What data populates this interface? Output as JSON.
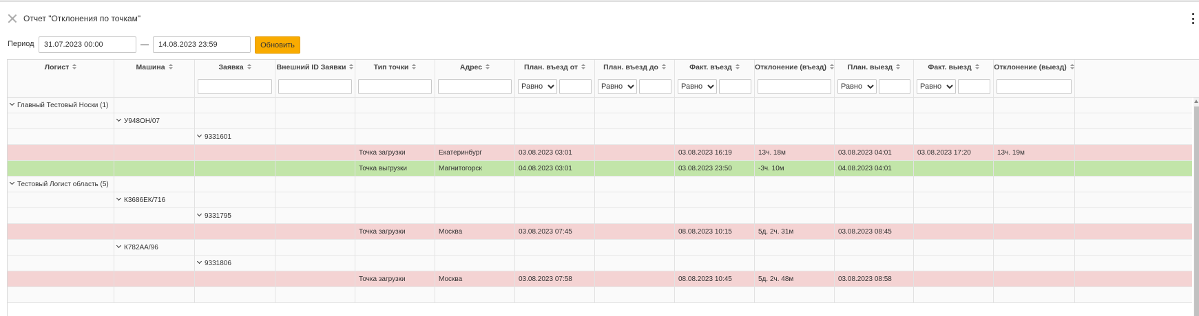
{
  "window": {
    "title": "Отчет \"Отклонения по точкам\""
  },
  "period": {
    "label": "Период",
    "from": "31.07.2023 00:00",
    "separator": "—",
    "to": "14.08.2023 23:59",
    "refresh_label": "Обновить"
  },
  "filter_option": "Равно",
  "columns": [
    {
      "key": "logist",
      "label": "Логист"
    },
    {
      "key": "car",
      "label": "Машина"
    },
    {
      "key": "order",
      "label": "Заявка"
    },
    {
      "key": "ext_id",
      "label": "Внешний ID Заявки"
    },
    {
      "key": "point_type",
      "label": "Тип точки"
    },
    {
      "key": "address",
      "label": "Адрес"
    },
    {
      "key": "plan_in_from",
      "label": "План. въезд от"
    },
    {
      "key": "plan_in_to",
      "label": "План. въезд до"
    },
    {
      "key": "fact_in",
      "label": "Факт. въезд"
    },
    {
      "key": "dev_in",
      "label": "Отклонение (въезд)"
    },
    {
      "key": "plan_out",
      "label": "План. выезд"
    },
    {
      "key": "fact_out",
      "label": "Факт. выезд"
    },
    {
      "key": "dev_out",
      "label": "Отклонение (выезд)"
    }
  ],
  "rows": [
    {
      "kind": "group",
      "level": 0,
      "label": "Главный Тестовый Носки (1)"
    },
    {
      "kind": "group",
      "level": 1,
      "label": "У948ОН/07"
    },
    {
      "kind": "group",
      "level": 2,
      "label": "9331601"
    },
    {
      "kind": "data",
      "status": "red",
      "cells": [
        "",
        "",
        "",
        "",
        "Точка загрузки",
        "Екатеринбург",
        "03.08.2023 03:01",
        "",
        "03.08.2023 16:19",
        "13ч. 18м",
        "03.08.2023 04:01",
        "03.08.2023 17:20",
        "13ч. 19м"
      ]
    },
    {
      "kind": "data",
      "status": "green",
      "cells": [
        "",
        "",
        "",
        "",
        "Точка выгрузки",
        "Магнитогорск",
        "04.08.2023 03:01",
        "",
        "03.08.2023 23:50",
        "-3ч. 10м",
        "04.08.2023 04:01",
        "",
        ""
      ]
    },
    {
      "kind": "group",
      "level": 0,
      "label": "Тестовый Логист область (5)"
    },
    {
      "kind": "group",
      "level": 1,
      "label": "К3686ЕК/716"
    },
    {
      "kind": "group",
      "level": 2,
      "label": "9331795"
    },
    {
      "kind": "data",
      "status": "red",
      "cells": [
        "",
        "",
        "",
        "",
        "Точка загрузки",
        "Москва",
        "03.08.2023 07:45",
        "",
        "08.08.2023 10:15",
        "5д. 2ч. 31м",
        "03.08.2023 08:45",
        "",
        ""
      ]
    },
    {
      "kind": "group",
      "level": 1,
      "label": "К782АА/96"
    },
    {
      "kind": "group",
      "level": 2,
      "label": "9331806"
    },
    {
      "kind": "data",
      "status": "red",
      "cells": [
        "",
        "",
        "",
        "",
        "Точка загрузки",
        "Москва",
        "03.08.2023 07:58",
        "",
        "08.08.2023 10:45",
        "5д. 2ч. 48м",
        "03.08.2023 08:58",
        "",
        ""
      ]
    },
    {
      "kind": "data",
      "status": "plain",
      "cells": [
        "",
        "",
        "",
        "",
        "",
        "",
        "",
        "",
        "",
        "",
        "",
        "",
        ""
      ]
    }
  ],
  "colors": {
    "accent": "#f9ab00",
    "late_row": "#f4d3d3",
    "early_row": "#c2e5a9"
  },
  "icons": {
    "close": "close-icon",
    "menu": "kebab-menu-icon",
    "sort": "sort-icon",
    "expand": "chevron-down-icon"
  }
}
